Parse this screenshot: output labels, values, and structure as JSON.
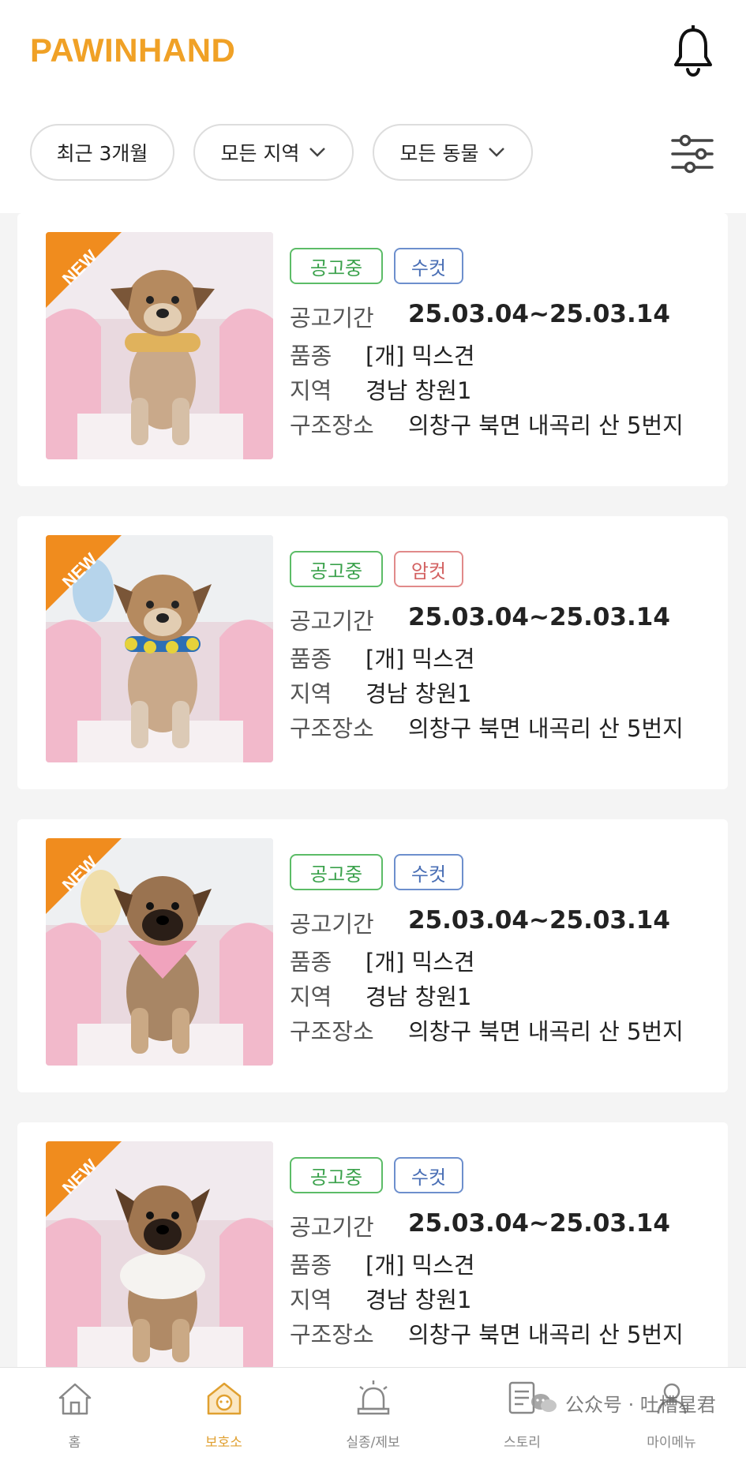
{
  "app": {
    "logo": "PAWINHAND"
  },
  "filters": [
    {
      "label": "최근 3개월",
      "has_dropdown": false
    },
    {
      "label": "모든 지역",
      "has_dropdown": true
    },
    {
      "label": "모든 동물",
      "has_dropdown": true
    }
  ],
  "colors": {
    "brand": "#f0a126",
    "status_green": "#3aa14b",
    "male_blue": "#4a6fb5",
    "female_red": "#d36262"
  },
  "icons": {
    "bell": "bell-icon",
    "filter": "sliders-icon"
  },
  "listings": [
    {
      "badge": "NEW",
      "status": "공고중",
      "sex": "수컷",
      "period_label": "공고기간",
      "period": "25.03.04~25.03.14",
      "breed_label": "품종",
      "breed": "[개] 믹스견",
      "region_label": "지역",
      "region": "경남 창원1",
      "place_label": "구조장소",
      "place": "의창구 북면 내곡리 산 5번지"
    },
    {
      "badge": "NEW",
      "status": "공고중",
      "sex": "암컷",
      "period_label": "공고기간",
      "period": "25.03.04~25.03.14",
      "breed_label": "품종",
      "breed": "[개] 믹스견",
      "region_label": "지역",
      "region": "경남 창원1",
      "place_label": "구조장소",
      "place": "의창구 북면 내곡리 산 5번지"
    },
    {
      "badge": "NEW",
      "status": "공고중",
      "sex": "수컷",
      "period_label": "공고기간",
      "period": "25.03.04~25.03.14",
      "breed_label": "품종",
      "breed": "[개] 믹스견",
      "region_label": "지역",
      "region": "경남 창원1",
      "place_label": "구조장소",
      "place": "의창구 북면 내곡리 산 5번지"
    },
    {
      "badge": "NEW",
      "status": "공고중",
      "sex": "수컷",
      "period_label": "공고기간",
      "period": "25.03.04~25.03.14",
      "breed_label": "품종",
      "breed": "[개] 믹스견",
      "region_label": "지역",
      "region": "경남 창원1",
      "place_label": "구조장소",
      "place": "의창구 북면 내곡리 산 5번지"
    }
  ],
  "nav": [
    {
      "label": "홈",
      "icon": "home-icon",
      "active": false
    },
    {
      "label": "보호소",
      "icon": "shelter-icon",
      "active": true
    },
    {
      "label": "실종/제보",
      "icon": "siren-icon",
      "active": false
    },
    {
      "label": "스토리",
      "icon": "story-icon",
      "active": false
    },
    {
      "label": "마이메뉴",
      "icon": "user-icon",
      "active": false
    }
  ],
  "watermark": {
    "text": "公众号 · 吐槽星君"
  }
}
